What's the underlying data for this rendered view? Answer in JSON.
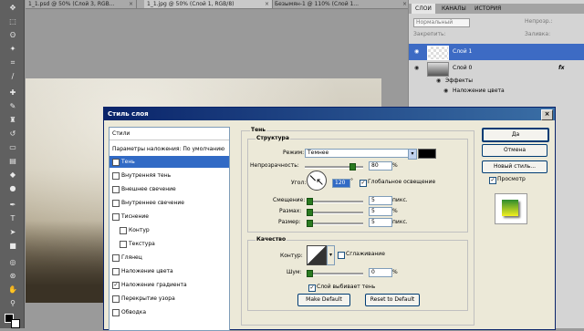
{
  "doc_tabs": [
    {
      "label": "1_1.psd @ 50% (Слой 3, RGB...",
      "active": false
    },
    {
      "label": "1_1.jpg @ 50% (Слой 1, RGB/8)",
      "active": true
    },
    {
      "label": "Безымян-1 @ 110% (Слой 1...",
      "active": false
    }
  ],
  "panel": {
    "tabs": [
      "СЛОИ",
      "КАНАЛЫ",
      "ИСТОРИЯ"
    ],
    "blend_mode": "Нормальный",
    "opacity_label": "Непрозр.:",
    "fill_label": "Заливка:",
    "lock_label": "Закрепить:",
    "layers": [
      {
        "name": "Слой 1",
        "selected": true
      },
      {
        "name": "Слой 0",
        "selected": false,
        "fx": "fx"
      }
    ],
    "effects_label": "Эффекты",
    "effect_item": "Наложение цвета"
  },
  "dialog": {
    "title": "Стиль слоя",
    "close": "×",
    "styles_header": "Стили",
    "blend_options": "Параметры наложения: По умолчанию",
    "items": [
      {
        "label": "Тень",
        "checked": true,
        "selected": true
      },
      {
        "label": "Внутренняя тень",
        "checked": false
      },
      {
        "label": "Внешнее свечение",
        "checked": false
      },
      {
        "label": "Внутреннее свечение",
        "checked": false
      },
      {
        "label": "Тиснение",
        "checked": false
      },
      {
        "label": "Контур",
        "checked": false,
        "indent": true
      },
      {
        "label": "Текстура",
        "checked": false,
        "indent": true
      },
      {
        "label": "Глянец",
        "checked": false
      },
      {
        "label": "Наложение цвета",
        "checked": false
      },
      {
        "label": "Наложение градиента",
        "checked": true
      },
      {
        "label": "Перекрытие узора",
        "checked": false
      },
      {
        "label": "Обводка",
        "checked": false
      }
    ],
    "section_title": "Тень",
    "structure": {
      "legend": "Структура",
      "mode_label": "Режим:",
      "mode_value": "Темнее",
      "opacity_label": "Непрозрачность:",
      "opacity_value": "80",
      "opacity_unit": "%",
      "angle_label": "Угол:",
      "angle_value": "120",
      "angle_unit": "°",
      "global_light": "Глобальное освещение",
      "offset_label": "Смещение:",
      "offset_value": "5",
      "offset_unit": "пикс.",
      "spread_label": "Размах:",
      "spread_value": "5",
      "spread_unit": "%",
      "size_label": "Размер:",
      "size_value": "5",
      "size_unit": "пикс."
    },
    "quality": {
      "legend": "Качество",
      "contour_label": "Контур:",
      "antialias": "Сглаживание",
      "noise_label": "Шум:",
      "noise_value": "0",
      "noise_unit": "%",
      "knockout": "Слой выбивает тень",
      "make_default": "Make Default",
      "reset_default": "Reset to Default"
    },
    "buttons": {
      "ok": "Да",
      "cancel": "Отмена",
      "new_style": "Новый стиль...",
      "preview": "Просмотр"
    },
    "colors": {
      "shadow_color": "#000000",
      "accent": "#316ac5"
    }
  }
}
